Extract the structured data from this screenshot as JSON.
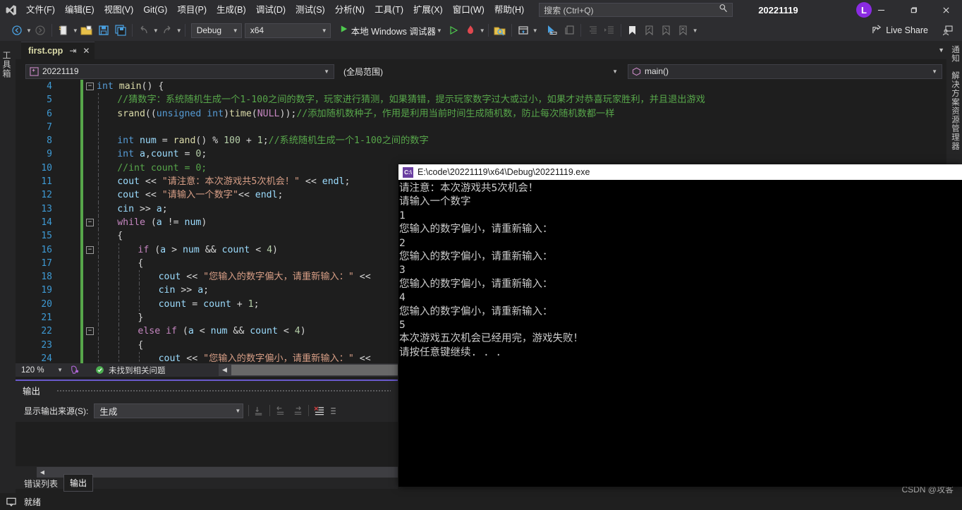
{
  "menubar": {
    "logo_icon": "visual-studio-logo",
    "items": [
      "文件(F)",
      "编辑(E)",
      "视图(V)",
      "Git(G)",
      "项目(P)",
      "生成(B)",
      "调试(D)",
      "测试(S)",
      "分析(N)",
      "工具(T)",
      "扩展(X)",
      "窗口(W)",
      "帮助(H)"
    ],
    "search_placeholder": "搜索 (Ctrl+Q)",
    "window_title": "20221119",
    "account_initial": "L",
    "minimize": "–",
    "restore": "❐",
    "close": "✕"
  },
  "toolbar": {
    "back_icon": "navigate-back-icon",
    "forward_icon": "navigate-forward-icon",
    "new_item_icon": "new-item-icon",
    "open_icon": "open-file-icon",
    "save_icon": "save-icon",
    "save_all_icon": "save-all-icon",
    "undo_icon": "undo-icon",
    "redo_icon": "redo-icon",
    "configuration": "Debug",
    "platform": "x64",
    "start_debug_label": "本地 Windows 调试器",
    "start_without_debug_icon": "start-without-debugging-icon",
    "hot_reload_icon": "hot-reload-icon",
    "solution_explorer_icon": "solution-explorer-search-icon",
    "window_layout_icon": "window-layout-icon",
    "pointer_icon": "pointer-select-icon",
    "comment_icon": "comment-block-icon",
    "indent_dec_icon": "decrease-indent-icon",
    "indent_inc_icon": "increase-indent-icon",
    "bookmark_icon": "bookmark-toggle-icon",
    "bookmark_prev_icon": "previous-bookmark-icon",
    "bookmark_next_icon": "next-bookmark-icon",
    "bookmark_clear_icon": "clear-bookmarks-icon",
    "overflow_icon": "toolbar-overflow-icon",
    "live_share_label": "Live Share",
    "live_share_icon": "live-share-icon",
    "feedback_icon": "send-feedback-icon"
  },
  "left_strip": {
    "toolbox_label": "工具箱"
  },
  "right_strip": {
    "notifications_label": "通知",
    "solution_explorer_label": "解决方案资源管理器"
  },
  "tabstrip": {
    "file_name": "first.cpp",
    "pin_icon": "pin-tab-icon",
    "close_icon": "close-tab-icon",
    "dropdown_icon": "tab-list-dropdown-icon",
    "settings_icon": "gear-icon"
  },
  "navbar": {
    "project": "20221119",
    "project_icon": "cpp-project-icon",
    "scope": "(全局范围)",
    "member": "main()",
    "member_icon": "method-cube-icon",
    "split_icon": "split-window-icon"
  },
  "editor": {
    "zoom_level": "120 %",
    "issues_status": "未找到相关问题",
    "issues_icon": "check-circle-icon",
    "intellicode_icon": "intellicode-icon",
    "lines": [
      {
        "n": "4",
        "fold": "−",
        "indent": 0,
        "tokens": [
          [
            "kw",
            "int"
          ],
          [
            "pl",
            " "
          ],
          [
            "fn",
            "main"
          ],
          [
            "pl",
            "() {"
          ]
        ]
      },
      {
        "n": "5",
        "fold": "",
        "indent": 1,
        "tokens": [
          [
            "cm",
            "//猜数字：系统随机生成一个1-100之间的数字，玩家进行猜测，如果猜错，提示玩家数字过大或过小，如果才对恭喜玩家胜利，并且退出游戏"
          ]
        ]
      },
      {
        "n": "6",
        "fold": "",
        "indent": 1,
        "tokens": [
          [
            "fn",
            "srand"
          ],
          [
            "pl",
            "(("
          ],
          [
            "kw",
            "unsigned int"
          ],
          [
            "pl",
            ")"
          ],
          [
            "fn",
            "time"
          ],
          [
            "pl",
            "("
          ],
          [
            "macro",
            "NULL"
          ],
          [
            "pl",
            "));"
          ],
          [
            "cm",
            "//添加随机数种子，作用是利用当前时间生成随机数，防止每次随机数都一样"
          ]
        ]
      },
      {
        "n": "7",
        "fold": "",
        "indent": 1,
        "tokens": []
      },
      {
        "n": "8",
        "fold": "",
        "indent": 1,
        "tokens": [
          [
            "kw",
            "int"
          ],
          [
            "pl",
            " "
          ],
          [
            "id",
            "num"
          ],
          [
            "pl",
            " = "
          ],
          [
            "fn",
            "rand"
          ],
          [
            "pl",
            "() % "
          ],
          [
            "num",
            "100"
          ],
          [
            "pl",
            " + "
          ],
          [
            "num",
            "1"
          ],
          [
            "pl",
            ";"
          ],
          [
            "cm",
            "//系统随机生成一个1-100之间的数字"
          ]
        ]
      },
      {
        "n": "9",
        "fold": "",
        "indent": 1,
        "tokens": [
          [
            "kw",
            "int"
          ],
          [
            "pl",
            " "
          ],
          [
            "id",
            "a"
          ],
          [
            "pl",
            ","
          ],
          [
            "id",
            "count"
          ],
          [
            "pl",
            " = "
          ],
          [
            "num",
            "0"
          ],
          [
            "pl",
            ";"
          ]
        ]
      },
      {
        "n": "10",
        "fold": "",
        "indent": 1,
        "tokens": [
          [
            "cm",
            "//int count = 0;"
          ]
        ]
      },
      {
        "n": "11",
        "fold": "",
        "indent": 1,
        "tokens": [
          [
            "id",
            "cout"
          ],
          [
            "pl",
            " << "
          ],
          [
            "st",
            "\"请注意：本次游戏共5次机会！\""
          ],
          [
            "pl",
            " << "
          ],
          [
            "id",
            "endl"
          ],
          [
            "pl",
            ";"
          ]
        ]
      },
      {
        "n": "12",
        "fold": "",
        "indent": 1,
        "tokens": [
          [
            "id",
            "cout"
          ],
          [
            "pl",
            " << "
          ],
          [
            "st",
            "\"请输入一个数字\""
          ],
          [
            "pl",
            "<< "
          ],
          [
            "id",
            "endl"
          ],
          [
            "pl",
            ";"
          ]
        ]
      },
      {
        "n": "13",
        "fold": "",
        "indent": 1,
        "tokens": [
          [
            "id",
            "cin"
          ],
          [
            "pl",
            " >> "
          ],
          [
            "id",
            "a"
          ],
          [
            "pl",
            ";"
          ]
        ]
      },
      {
        "n": "14",
        "fold": "−",
        "indent": 1,
        "tokens": [
          [
            "kwp",
            "while"
          ],
          [
            "pl",
            " ("
          ],
          [
            "id",
            "a"
          ],
          [
            "pl",
            " != "
          ],
          [
            "id",
            "num"
          ],
          [
            "pl",
            ")"
          ]
        ]
      },
      {
        "n": "15",
        "fold": "",
        "indent": 1,
        "tokens": [
          [
            "pl",
            "{"
          ]
        ]
      },
      {
        "n": "16",
        "fold": "−",
        "indent": 2,
        "tokens": [
          [
            "kwp",
            "if"
          ],
          [
            "pl",
            " ("
          ],
          [
            "id",
            "a"
          ],
          [
            "pl",
            " > "
          ],
          [
            "id",
            "num"
          ],
          [
            "pl",
            " && "
          ],
          [
            "id",
            "count"
          ],
          [
            "pl",
            " < "
          ],
          [
            "num",
            "4"
          ],
          [
            "pl",
            ")"
          ]
        ]
      },
      {
        "n": "17",
        "fold": "",
        "indent": 2,
        "tokens": [
          [
            "pl",
            "{"
          ]
        ]
      },
      {
        "n": "18",
        "fold": "",
        "indent": 3,
        "tokens": [
          [
            "id",
            "cout"
          ],
          [
            "pl",
            " << "
          ],
          [
            "st",
            "\"您输入的数字偏大，请重新输入：\""
          ],
          [
            "pl",
            " <<"
          ]
        ]
      },
      {
        "n": "19",
        "fold": "",
        "indent": 3,
        "tokens": [
          [
            "id",
            "cin"
          ],
          [
            "pl",
            " >> "
          ],
          [
            "id",
            "a"
          ],
          [
            "pl",
            ";"
          ]
        ]
      },
      {
        "n": "20",
        "fold": "",
        "indent": 3,
        "tokens": [
          [
            "id",
            "count"
          ],
          [
            "pl",
            " = "
          ],
          [
            "id",
            "count"
          ],
          [
            "pl",
            " + "
          ],
          [
            "num",
            "1"
          ],
          [
            "pl",
            ";"
          ]
        ]
      },
      {
        "n": "21",
        "fold": "",
        "indent": 2,
        "tokens": [
          [
            "pl",
            "}"
          ]
        ]
      },
      {
        "n": "22",
        "fold": "−",
        "indent": 2,
        "tokens": [
          [
            "kwp",
            "else if"
          ],
          [
            "pl",
            " ("
          ],
          [
            "id",
            "a"
          ],
          [
            "pl",
            " < "
          ],
          [
            "id",
            "num"
          ],
          [
            "pl",
            " && "
          ],
          [
            "id",
            "count"
          ],
          [
            "pl",
            " < "
          ],
          [
            "num",
            "4"
          ],
          [
            "pl",
            ")"
          ]
        ]
      },
      {
        "n": "23",
        "fold": "",
        "indent": 2,
        "tokens": [
          [
            "pl",
            "{"
          ]
        ]
      },
      {
        "n": "24",
        "fold": "",
        "indent": 3,
        "tokens": [
          [
            "id",
            "cout"
          ],
          [
            "pl",
            " << "
          ],
          [
            "st",
            "\"您输入的数字偏小，请重新输入：\""
          ],
          [
            "pl",
            " <<"
          ]
        ]
      }
    ]
  },
  "output_panel": {
    "title": "输出",
    "source_label": "显示输出来源(S):",
    "source_value": "生成",
    "toolbar_icons": [
      "go-to-message-icon",
      "previous-message-icon",
      "next-message-icon",
      "clear-all-icon",
      "word-wrap-icon"
    ],
    "tabs": [
      {
        "label": "错误列表",
        "active": false
      },
      {
        "label": "输出",
        "active": true
      }
    ]
  },
  "statusbar": {
    "ready_text": "就绪",
    "ready_icon": "status-ready-icon",
    "watermark": "CSDN @攻客"
  },
  "console": {
    "icon_label": "C:\\",
    "title": "E:\\code\\20221119\\x64\\Debug\\20221119.exe",
    "lines": [
      "请注意：本次游戏共5次机会！",
      "请输入一个数字",
      "1",
      "您输入的数字偏小，请重新输入：",
      "2",
      "您输入的数字偏小，请重新输入：",
      "3",
      "您输入的数字偏小，请重新输入：",
      "4",
      "您输入的数字偏小，请重新输入：",
      "5",
      "本次游戏五次机会已经用完，游戏失败！",
      "请按任意键继续. . ."
    ]
  },
  "colors": {
    "accent_purple": "#6a5acd",
    "chrome_bg": "#2d2d30",
    "editor_bg": "#1e1e1e",
    "change_bar_green": "#57a64a",
    "comment_green": "#57a64a",
    "string_orange": "#d69d85",
    "keyword_blue": "#569cd6",
    "control_purple": "#c586c0"
  }
}
